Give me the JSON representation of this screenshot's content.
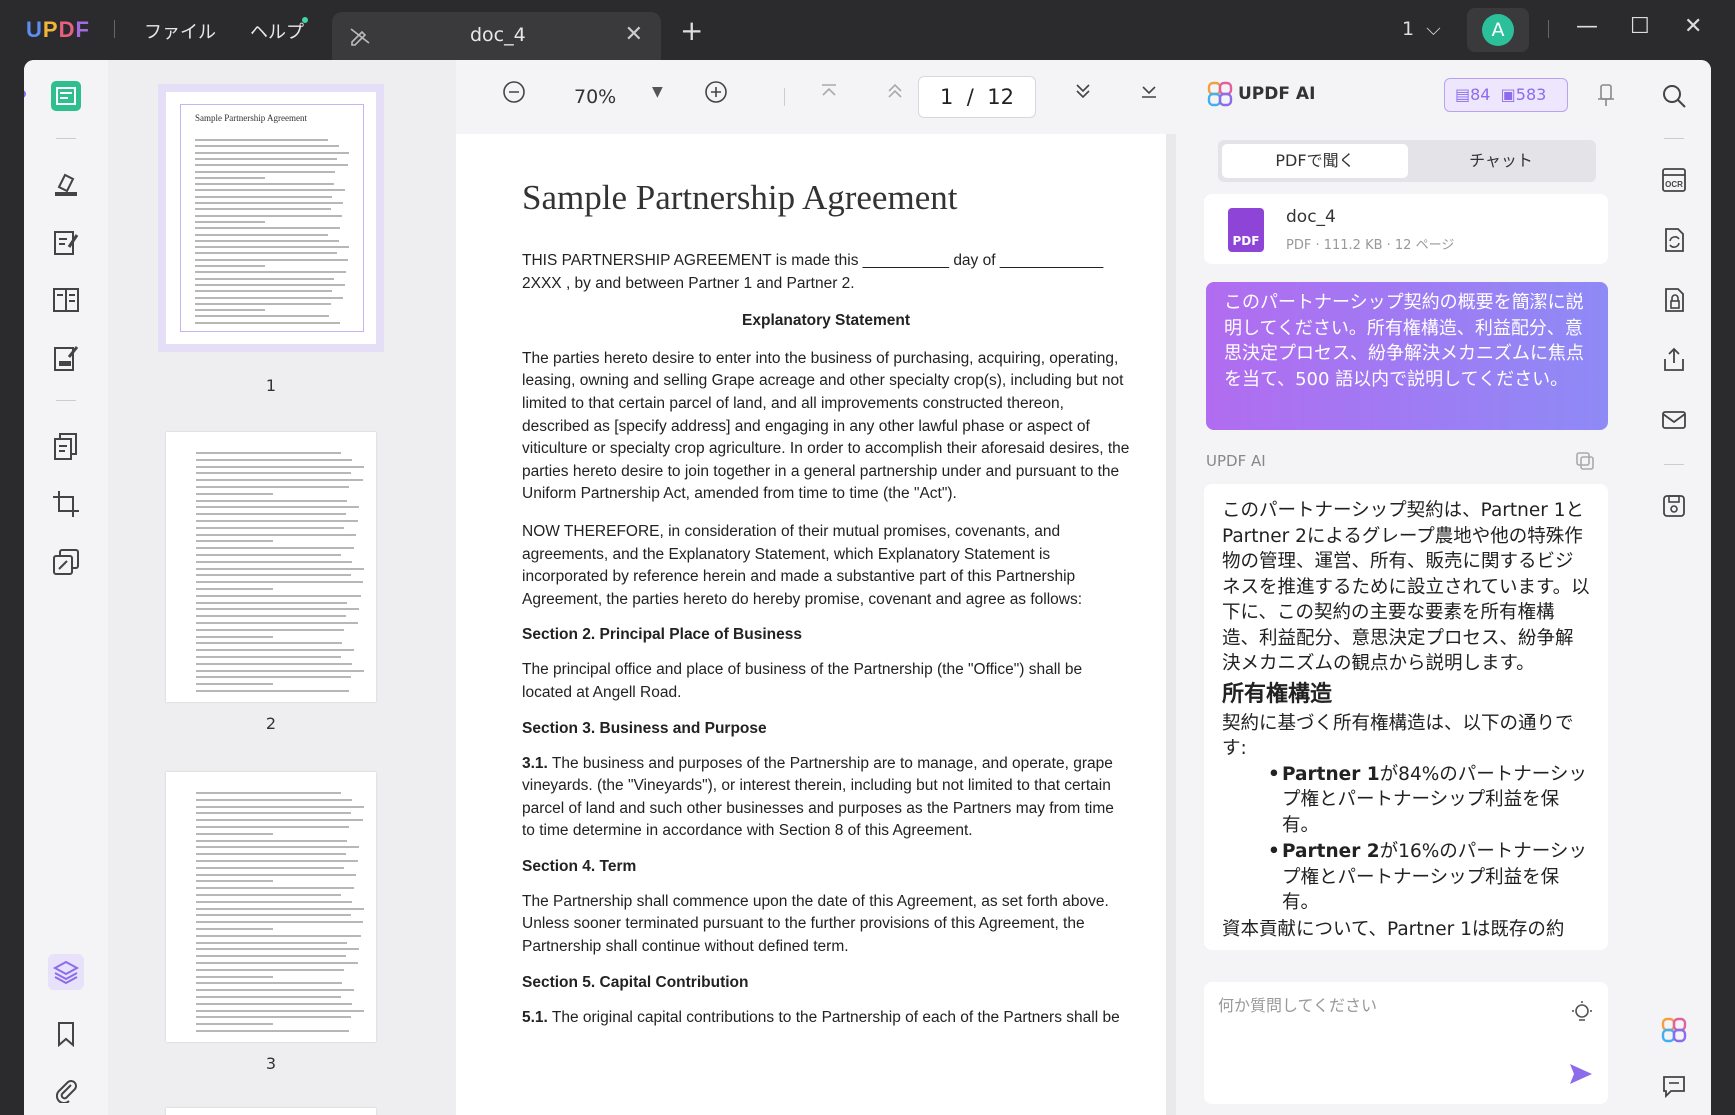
{
  "titlebar": {
    "menu_file": "ファイル",
    "menu_help": "ヘルプ",
    "tab_title": "doc_4",
    "page_select": "1",
    "avatar_letter": "A"
  },
  "viewer": {
    "zoom": "70%",
    "current_page": "1",
    "page_separator": "/",
    "total_pages": "12"
  },
  "thumbnails": [
    {
      "number": "1",
      "selected": true
    },
    {
      "number": "2",
      "selected": false
    },
    {
      "number": "3",
      "selected": false
    }
  ],
  "document": {
    "title": "Sample Partnership Agreement",
    "p1": "THIS PARTNERSHIP AGREEMENT is made this __________ day of ____________ 2XXX , by and between Partner 1 and Partner 2.",
    "explanatory": "Explanatory Statement",
    "p2": "The parties hereto desire to enter into the business of purchasing, acquiring, operating, leasing, owning and selling Grape acreage and other specialty crop(s), including but not limited to that certain parcel of land, and all improvements constructed thereon, described as [specify address] and engaging in any other lawful phase or aspect of viticulture or specialty crop agriculture. In order to accomplish their aforesaid desires, the parties hereto desire to join together in a general partnership under and pursuant to the Uniform Partnership Act, amended from time to time (the \"Act\").",
    "p3": "NOW THEREFORE, in consideration of their mutual promises, covenants, and agreements, and the Explanatory Statement, which Explanatory Statement is incorporated by reference herein and made a substantive part of this Partnership Agreement, the parties hereto do hereby promise, covenant and agree as follows:",
    "s2": "Section 2. Principal Place of Business",
    "p4": "The principal office and place of business of the Partnership (the \"Office\") shall be located at Angell Road.",
    "s3": "Section 3. Business and Purpose",
    "p5_num": "3.1.",
    "p5": " The business and purposes of the Partnership are to manage, and operate, grape vineyards. (the \"Vineyards\"), or interest therein, including but not limited to that certain parcel of land and such other businesses and purposes as the Partners may from time to time determine in accordance with Section 8 of this Agreement.",
    "s4": "Section 4. Term",
    "p6": "The Partnership shall commence upon the date of this Agreement, as set forth above. Unless sooner terminated pursuant to the further provisions of this Agreement, the Partnership shall continue without defined term.",
    "s5": "Section 5. Capital Contribution",
    "p7_num": "5.1.",
    "p7": " The original capital contributions to the Partnership of each of the Partners shall be"
  },
  "ai_panel": {
    "title": "UPDF AI",
    "quota_pages": "84",
    "quota_chats": "583",
    "tab_ask_pdf": "PDFで聞く",
    "tab_chat": "チャット",
    "file_name": "doc_4",
    "file_meta": "PDF · 111.2 KB · 12 ページ",
    "file_badge": "PDF",
    "prompt": "このパートナーシップ契約の概要を簡潔に説明してください。所有権構造、利益配分、意思決定プロセス、紛争解決メカニズムに焦点を当て、500 語以内で説明してください。",
    "answer_label": "UPDF AI",
    "answer_intro": "このパートナーシップ契約は、Partner 1とPartner 2によるグレープ農地や他の特殊作物の管理、運営、所有、販売に関するビジネスを推進するために設立されています。以下に、この契約の主要な要素を所有権構造、利益配分、意思決定プロセス、紛争解決メカニズムの観点から説明します。",
    "answer_heading": "所有権構造",
    "answer_sub": "契約に基づく所有権構造は、以下の通りです:",
    "bullet1_bold": "Partner 1",
    "bullet1_text": "が84%のパートナーシップ権とパートナーシップ利益を保有。",
    "bullet2_bold": "Partner 2",
    "bullet2_text": "が16%のパートナーシップ権とパートナーシップ利益を保有。",
    "answer_tail": "資本貢献について、Partner 1は既存の約",
    "input_placeholder": "何か質問してください"
  },
  "colors": {
    "accent": "#8c6cea",
    "prompt_start": "#b16cf0",
    "prompt_end": "#8e8af6"
  }
}
